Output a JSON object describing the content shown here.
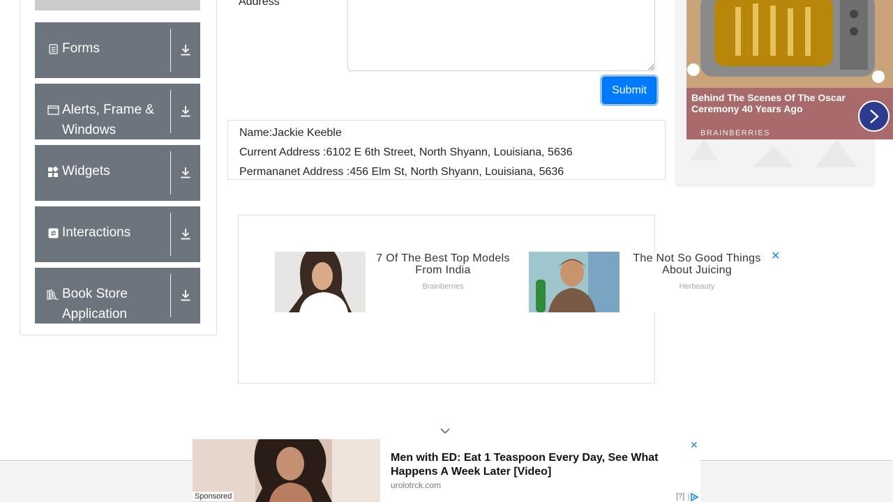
{
  "sidebar": {
    "groups": [
      {
        "label": "Forms",
        "icon": "document-icon"
      },
      {
        "label": "Alerts, Frame &",
        "label2": "Windows",
        "icon": "window-icon"
      },
      {
        "label": "Widgets",
        "icon": "widgets-icon"
      },
      {
        "label": "Interactions",
        "icon": "interactions-icon"
      },
      {
        "label": "Book Store",
        "label2": "Application",
        "icon": "books-icon"
      }
    ]
  },
  "form": {
    "address_label": "Address",
    "submit_label": "Submit"
  },
  "output": {
    "name": "Name:Jackie Keeble",
    "current_address": "Current Address :6102 E 6th Street, North Shyann, Louisiana, 5636",
    "permanent_address": "Permananet Address :456 Elm St, North Shyann, Louisiana, 5636"
  },
  "right_ad": {
    "title": "Behind The Scenes Of The Oscar Ceremony 40 Years Ago",
    "source": "BRAINBERRIES"
  },
  "mid_ads": [
    {
      "headline": "7 Of The Best Top Models From India",
      "source": "Brainberries"
    },
    {
      "headline": "The Not So Good Things About Juicing",
      "source": "Herbeauty"
    }
  ],
  "bottom_ad": {
    "sponsored": "Sponsored",
    "title": "Men with ED: Eat 1 Teaspoon Every Day, See What Happens A Week Later [Video]",
    "source": "urolotrck.com",
    "help": "[?]"
  },
  "colors": {
    "sidebar_group": "#6c757d",
    "submit": "#007bff",
    "ad_close": "#1e88e5"
  }
}
